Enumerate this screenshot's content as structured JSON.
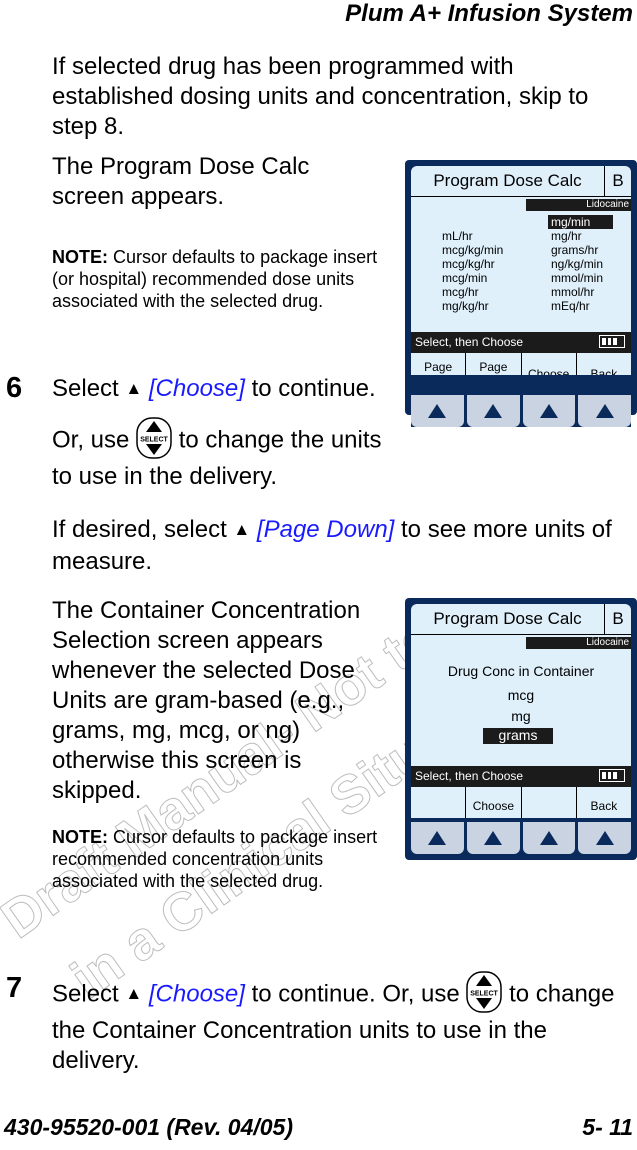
{
  "header": {
    "title": "Plum A+ Infusion System"
  },
  "intro": "If selected drug has been programmed with established dosing units and concentration, skip to step 8.",
  "screen_appears": "The Program Dose Calc screen appears.",
  "note1": {
    "label": "NOTE:",
    "text": " Cursor defaults to package insert (or hospital) recommended dose units associated with the selected drug."
  },
  "step6": {
    "number": "6",
    "line1_pre": "Select ",
    "line1_link": "[Choose]",
    "line1_post": " to continue.",
    "line2_pre": "Or, use ",
    "line2_post": " to change the units to use in the delivery.",
    "line3_pre": "If desired, select ",
    "line3_link": "[Page Down]",
    "line3_post": " to see more units of measure."
  },
  "container_text": "The Container Concentration Selection screen appears whenever the selected Dose Units are gram-based (e.g., grams, mg, mcg, or ng) otherwise this screen is skipped.",
  "note2": {
    "label": "NOTE:",
    "text": " Cursor defaults to package insert recommended concentration units associated with the selected drug."
  },
  "step7": {
    "number": "7",
    "pre": "Select ",
    "link": "[Choose]",
    "mid": " to continue. Or, use ",
    "post": " to change the Container Concentration units to use in the delivery."
  },
  "triangle_glyph": "▲",
  "select_button_label": "SELECT",
  "footer": {
    "doc_number": "430-95520-001 (Rev. 04/05)",
    "page": "5- 11"
  },
  "watermark": {
    "line1": "Draft Manual- Not to",
    "line2": "in a Clinical Situation"
  },
  "screen1": {
    "title": "Program Dose Calc",
    "channel": "B",
    "drug": "Lidocaine",
    "left_units": [
      "mL/hr",
      "mcg/kg/min",
      "mcg/kg/hr",
      "mcg/min",
      "mcg/hr",
      "mg/kg/hr"
    ],
    "right_units": [
      "mg/min",
      "mg/hr",
      "grams/hr",
      "ng/kg/min",
      "mmol/min",
      "mmol/hr",
      "mEq/hr"
    ],
    "selected_unit": "mg/min",
    "status": "Select, then Choose",
    "softkeys": [
      "Page\nUp",
      "Page\nDown",
      "Choose",
      "Back"
    ]
  },
  "screen2": {
    "title": "Program Dose Calc",
    "channel": "B",
    "drug": "Lidocaine",
    "heading": "Drug Conc in Container",
    "options": [
      "mcg",
      "mg",
      "grams"
    ],
    "selected_option": "grams",
    "status": "Select, then Choose",
    "softkeys": [
      "",
      "Choose",
      "",
      "Back"
    ]
  }
}
